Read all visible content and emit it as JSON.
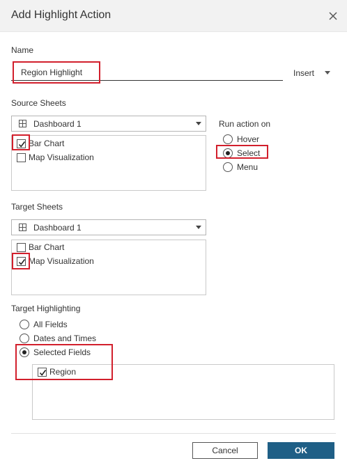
{
  "dialog": {
    "title": "Add Highlight Action"
  },
  "name_section": {
    "label": "Name",
    "value": "Region Highlight",
    "insert_label": "Insert"
  },
  "source_sheets": {
    "label": "Source Sheets",
    "dropdown_value": "Dashboard 1",
    "items": [
      {
        "label": "Bar Chart",
        "checked": true
      },
      {
        "label": "Map Visualization",
        "checked": false
      }
    ]
  },
  "run_action": {
    "label": "Run action on",
    "options": [
      {
        "label": "Hover",
        "selected": false
      },
      {
        "label": "Select",
        "selected": true
      },
      {
        "label": "Menu",
        "selected": false
      }
    ]
  },
  "target_sheets": {
    "label": "Target Sheets",
    "dropdown_value": "Dashboard 1",
    "items": [
      {
        "label": "Bar Chart",
        "checked": false
      },
      {
        "label": "Map Visualization",
        "checked": true
      }
    ]
  },
  "target_highlighting": {
    "label": "Target Highlighting",
    "options": [
      {
        "label": "All Fields",
        "selected": false
      },
      {
        "label": "Dates and Times",
        "selected": false
      },
      {
        "label": "Selected Fields",
        "selected": true
      }
    ],
    "fields": [
      {
        "label": "Region",
        "checked": true
      }
    ]
  },
  "footer": {
    "cancel_label": "Cancel",
    "ok_label": "OK"
  },
  "colors": {
    "highlight_border": "#d21f2c",
    "primary_button": "#1f5f86"
  }
}
